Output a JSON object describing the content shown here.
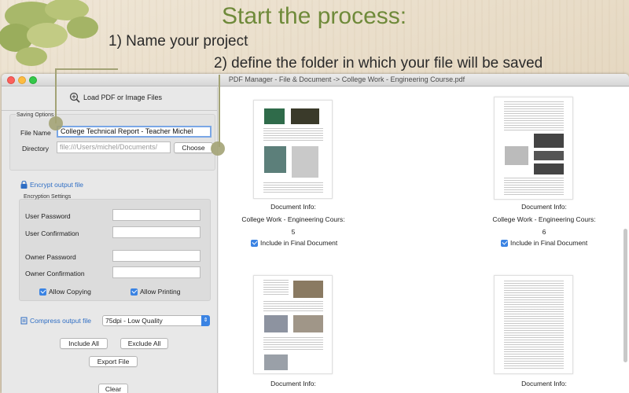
{
  "annotation": {
    "headline": "Start the process:",
    "step1": "1) Name your project",
    "step2": "2) define the folder  in which your file will be saved"
  },
  "window": {
    "title": "PDF Manager - File & Document -> College Work - Engineering Course.pdf"
  },
  "left_panel": {
    "load_button": "Load PDF or Image Files",
    "saving_options": {
      "legend": "Saving Options",
      "file_name_label": "File Name",
      "file_name_value": "College Technical Report - Teacher Michel",
      "directory_label": "Directory",
      "directory_placeholder": "file:///Users/michel/Documents/",
      "choose_button": "Choose"
    },
    "encrypt_link": "Encrypt output file",
    "encryption": {
      "legend": "Encryption Settings",
      "user_password_label": "User Password",
      "user_confirmation_label": "User Confirmation",
      "owner_password_label": "Owner Password",
      "owner_confirmation_label": "Owner Confirmation",
      "allow_copying_label": "Allow Copying",
      "allow_printing_label": "Allow Printing"
    },
    "compress_link": "Compress output file",
    "compress_select_value": "75dpi - Low Quality",
    "include_all_button": "Include All",
    "exclude_all_button": "Exclude All",
    "export_button": "Export File",
    "clear_button": "Clear"
  },
  "documents": [
    {
      "info_label": "Document Info:",
      "name": "College Work - Engineering Cours:",
      "page": "5",
      "include_label": "Include in Final Document"
    },
    {
      "info_label": "Document Info:",
      "name": "College Work - Engineering Cours:",
      "page": "6",
      "include_label": "Include in Final Document"
    },
    {
      "info_label": "Document Info:"
    },
    {
      "info_label": "Document Info:"
    }
  ],
  "colors": {
    "headline": "#6f8a3a",
    "link": "#2f6ec4",
    "checkbox": "#3a83e3",
    "callout": "#a3a376"
  }
}
